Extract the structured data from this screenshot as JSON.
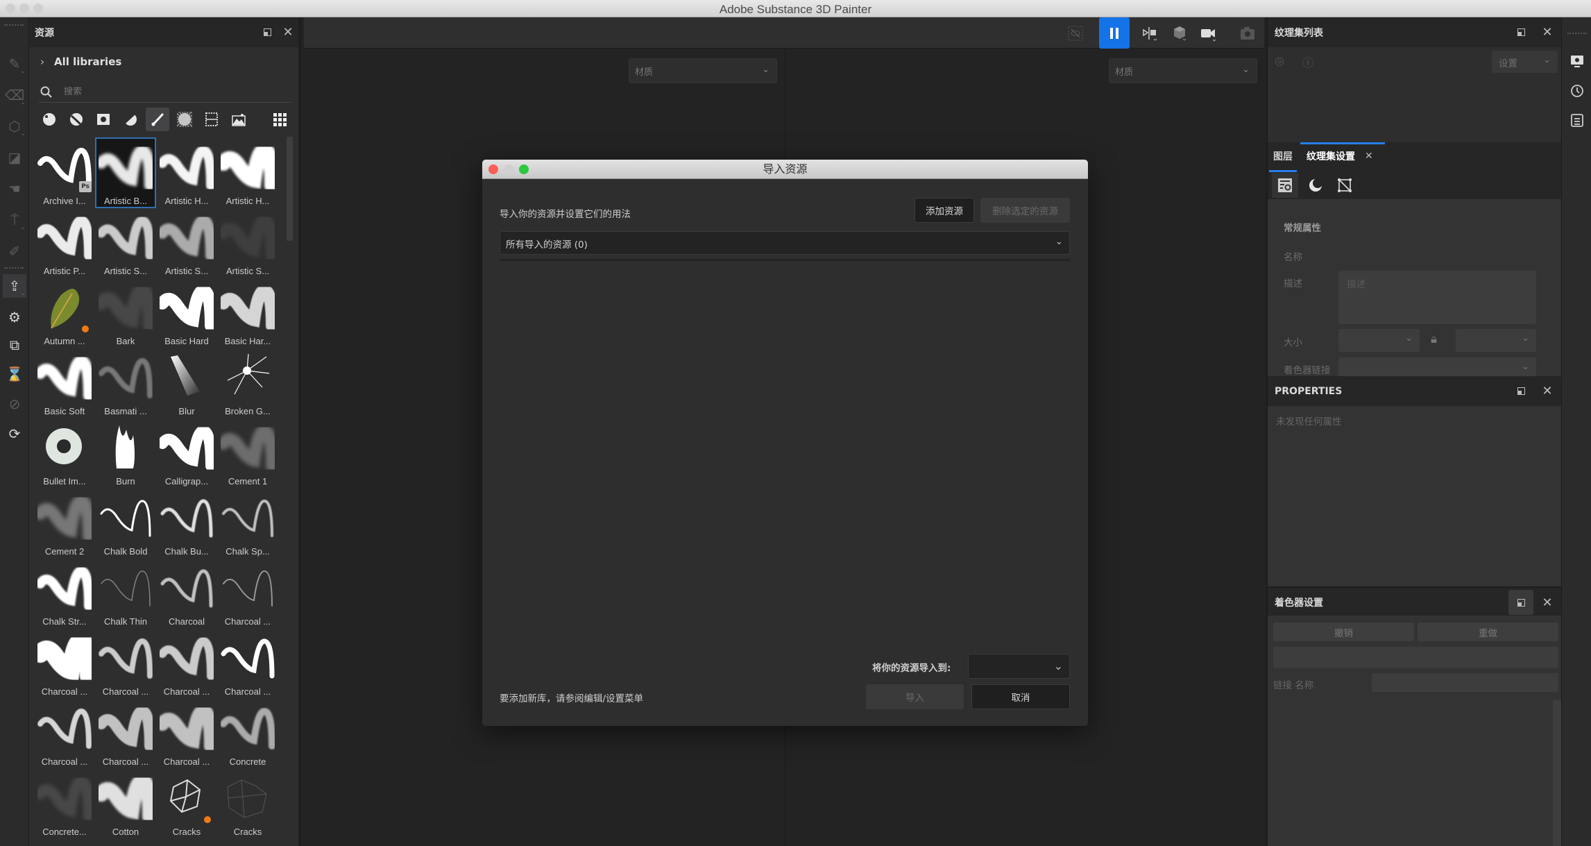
{
  "window": {
    "title": "Adobe Substance 3D Painter"
  },
  "toolstrip": {
    "tools": [
      {
        "name": "paint-brush-icon",
        "glyph": "✎"
      },
      {
        "name": "eraser-icon",
        "glyph": "⌫"
      },
      {
        "name": "projection-icon",
        "glyph": "⬡"
      },
      {
        "name": "polygon-fill-icon",
        "glyph": "◪"
      },
      {
        "name": "smudge-icon",
        "glyph": "☚"
      },
      {
        "name": "clone-stamp-icon",
        "glyph": "⍑"
      },
      {
        "name": "color-picker-icon",
        "glyph": "✐"
      },
      {
        "name": "export-icon",
        "glyph": "⇪"
      },
      {
        "name": "substance-icon",
        "glyph": "⚙"
      },
      {
        "name": "bake-icon",
        "glyph": "⧉"
      },
      {
        "name": "hourglass-icon",
        "glyph": "⌛"
      },
      {
        "name": "uv-disabled-icon",
        "glyph": "⊘"
      },
      {
        "name": "refresh-doc-icon",
        "glyph": "⟳"
      }
    ]
  },
  "assets": {
    "title": "资源",
    "libraries_label": "All libraries",
    "search_placeholder": "搜索",
    "filters": [
      "material-icon",
      "smart-material-icon",
      "mask-icon",
      "smart-mask-icon",
      "brush-icon",
      "alpha-icon",
      "texture-icon",
      "environment-icon",
      "grid-view-icon"
    ],
    "active_filter": "brush-icon",
    "items": [
      {
        "label": "Archive I...",
        "badge": "Ps"
      },
      {
        "label": "Artistic B...",
        "selected": true
      },
      {
        "label": "Artistic H..."
      },
      {
        "label": "Artistic H..."
      },
      {
        "label": "Artistic P..."
      },
      {
        "label": "Artistic S..."
      },
      {
        "label": "Artistic S..."
      },
      {
        "label": "Artistic S..."
      },
      {
        "label": "Autumn ...",
        "badge": "substance"
      },
      {
        "label": "Bark"
      },
      {
        "label": "Basic Hard"
      },
      {
        "label": "Basic Har..."
      },
      {
        "label": "Basic Soft"
      },
      {
        "label": "Basmati ..."
      },
      {
        "label": "Blur"
      },
      {
        "label": "Broken G..."
      },
      {
        "label": "Bullet Im..."
      },
      {
        "label": "Burn"
      },
      {
        "label": "Calligrap..."
      },
      {
        "label": "Cement 1"
      },
      {
        "label": "Cement 2"
      },
      {
        "label": "Chalk Bold"
      },
      {
        "label": "Chalk Bu..."
      },
      {
        "label": "Chalk Sp..."
      },
      {
        "label": "Chalk Str..."
      },
      {
        "label": "Chalk Thin"
      },
      {
        "label": "Charcoal"
      },
      {
        "label": "Charcoal ..."
      },
      {
        "label": "Charcoal ..."
      },
      {
        "label": "Charcoal ..."
      },
      {
        "label": "Charcoal ..."
      },
      {
        "label": "Charcoal ..."
      },
      {
        "label": "Charcoal ..."
      },
      {
        "label": "Charcoal ..."
      },
      {
        "label": "Charcoal ..."
      },
      {
        "label": "Concrete"
      },
      {
        "label": "Concrete..."
      },
      {
        "label": "Cotton"
      },
      {
        "label": "Cracks",
        "badge": "substance"
      },
      {
        "label": "Cracks"
      }
    ]
  },
  "viewport": {
    "left_dropdown": "材质",
    "right_dropdown": "材质",
    "toolbar": [
      "hide-selection-icon",
      "pause-icon",
      "split-view-icon",
      "display-icon",
      "camera-icon",
      "screenshot-icon"
    ],
    "accent": "#1473e6"
  },
  "dialog": {
    "title": "导入资源",
    "instruction": "导入你的资源并设置它们的用法",
    "add_button": "添加资源",
    "remove_button": "删除选定的资源",
    "filter_value": "所有导入的资源 (0)",
    "dest_label": "将你的资源导入到:",
    "dest_value": "",
    "footer_note": "要添加新库，请参阅编辑/设置菜单",
    "import_button": "导入",
    "cancel_button": "取消"
  },
  "right": {
    "texture_set_list": {
      "title": "纹理集列表",
      "settings_dropdown": "设置"
    },
    "tabs": [
      {
        "label": "图层",
        "active": false
      },
      {
        "label": "纹理集设置",
        "active": true
      }
    ],
    "texture_set_settings": {
      "section": "常规属性",
      "name_label": "名称",
      "desc_label": "描述",
      "desc_placeholder": "描述",
      "size_label": "大小",
      "shader_link_label": "着色器链接"
    },
    "properties": {
      "title": "PROPERTIES",
      "empty_text": "未发现任何属性"
    },
    "shader_settings": {
      "title": "着色器设置",
      "undo_button": "撤销",
      "redo_button": "重做",
      "link_name_label": "链接 名称"
    }
  }
}
